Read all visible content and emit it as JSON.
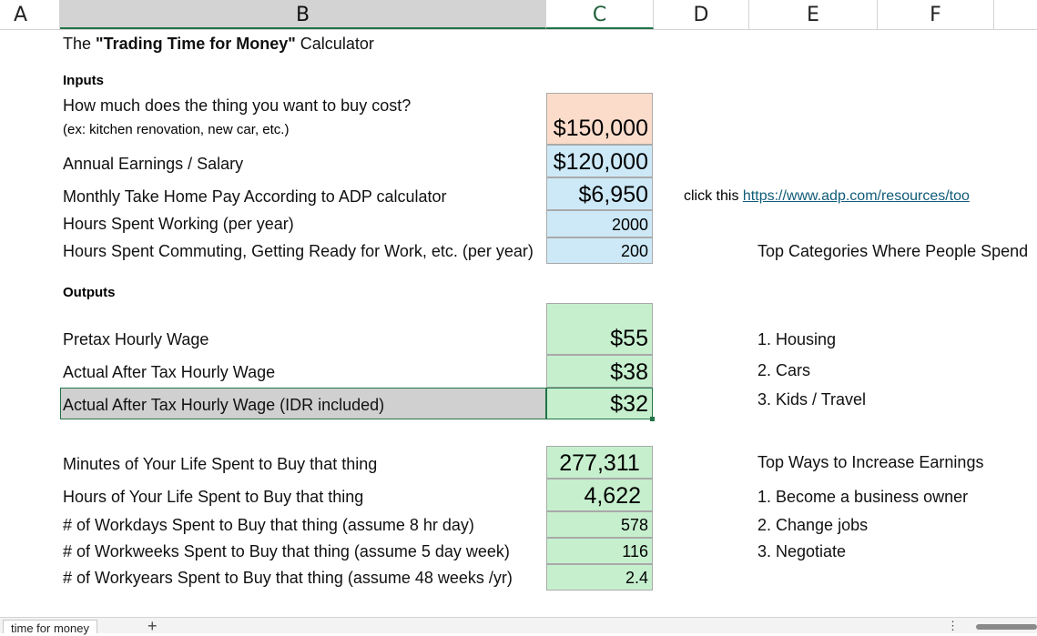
{
  "columns": [
    "A",
    "B",
    "C",
    "D",
    "E",
    "F"
  ],
  "title": {
    "prefix": "The ",
    "bold": "\"Trading Time for Money\"",
    "suffix": " Calculator"
  },
  "inputs": {
    "heading": "Inputs",
    "cost_label": "How much does the thing you want to buy cost?",
    "cost_example": "(ex: kitchen renovation, new car, etc.)",
    "cost_value": "$150,000",
    "salary_label": "Annual Earnings / Salary",
    "salary_value": "$120,000",
    "takehome_label": "Monthly Take Home Pay According to ADP calculator",
    "takehome_value": "$6,950",
    "hours_label": "Hours Spent Working (per year)",
    "hours_value": "2000",
    "commute_label": "Hours Spent Commuting, Getting Ready for Work, etc. (per year)",
    "commute_value": "200"
  },
  "adp": {
    "prefix": "click this ",
    "link": "https://www.adp.com/resources/too"
  },
  "outputs": {
    "heading": "Outputs",
    "pretax_label": "Pretax Hourly Wage",
    "pretax_value": "$55",
    "aftertax_label": "Actual After Tax Hourly Wage",
    "aftertax_value": "$38",
    "idr_label": "Actual After Tax Hourly Wage (IDR included)",
    "idr_value": "$32",
    "minutes_label": "Minutes of Your Life Spent to Buy that thing",
    "minutes_value": "277,311",
    "hours_label": "Hours of Your Life Spent to Buy that thing",
    "hours_value": "4,622",
    "workdays_label": "# of Workdays Spent to Buy that thing (assume 8 hr day)",
    "workdays_value": "578",
    "workweeks_label": "# of Workweeks Spent to Buy that thing (assume 5 day week)",
    "workweeks_value": "116",
    "workyears_label": "# of Workyears Spent to Buy that thing (assume 48 weeks /yr)",
    "workyears_value": "2.4"
  },
  "spend": {
    "heading": "Top Categories Where People Spend",
    "items": [
      "1. Housing",
      "2. Cars",
      "3. Kids / Travel"
    ]
  },
  "earn": {
    "heading": "Top Ways to Increase Earnings",
    "items": [
      "1. Become a business owner",
      "2. Change jobs",
      "3. Negotiate"
    ]
  },
  "sheet": {
    "tab_name": "time for money",
    "add_symbol": "+",
    "more_symbol": "⋮"
  }
}
